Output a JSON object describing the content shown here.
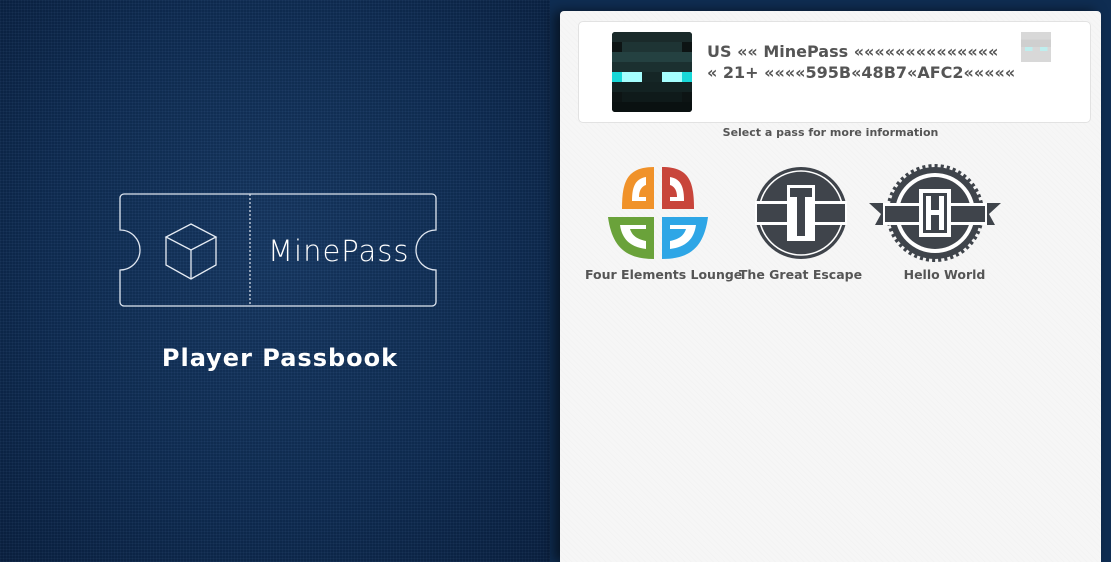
{
  "app": {
    "brand": "MinePass",
    "subtitle": "Player Passbook"
  },
  "pass_card": {
    "line1": "US «« MinePass ««««««««««««««",
    "line2": "« 21+ ««««595B«48B7«AFC2«««««",
    "avatar_icon": "enderman-face-icon",
    "mini_icon": "enderman-thumbnail-icon"
  },
  "hint": "Select a pass for more information",
  "passes": [
    {
      "label": "Four Elements Lounge",
      "icon": "four-elements-logo"
    },
    {
      "label": "The Great Escape",
      "icon": "great-escape-logo"
    },
    {
      "label": "Hello World",
      "icon": "hello-world-logo"
    }
  ],
  "colors": {
    "background": "#0f2d52",
    "panel": "#f6f6f6",
    "text": "#555555",
    "orange": "#f0922a",
    "red": "#c8453b",
    "green": "#6aa23a",
    "blue": "#2ea6e6",
    "badge": "#3f444b"
  }
}
